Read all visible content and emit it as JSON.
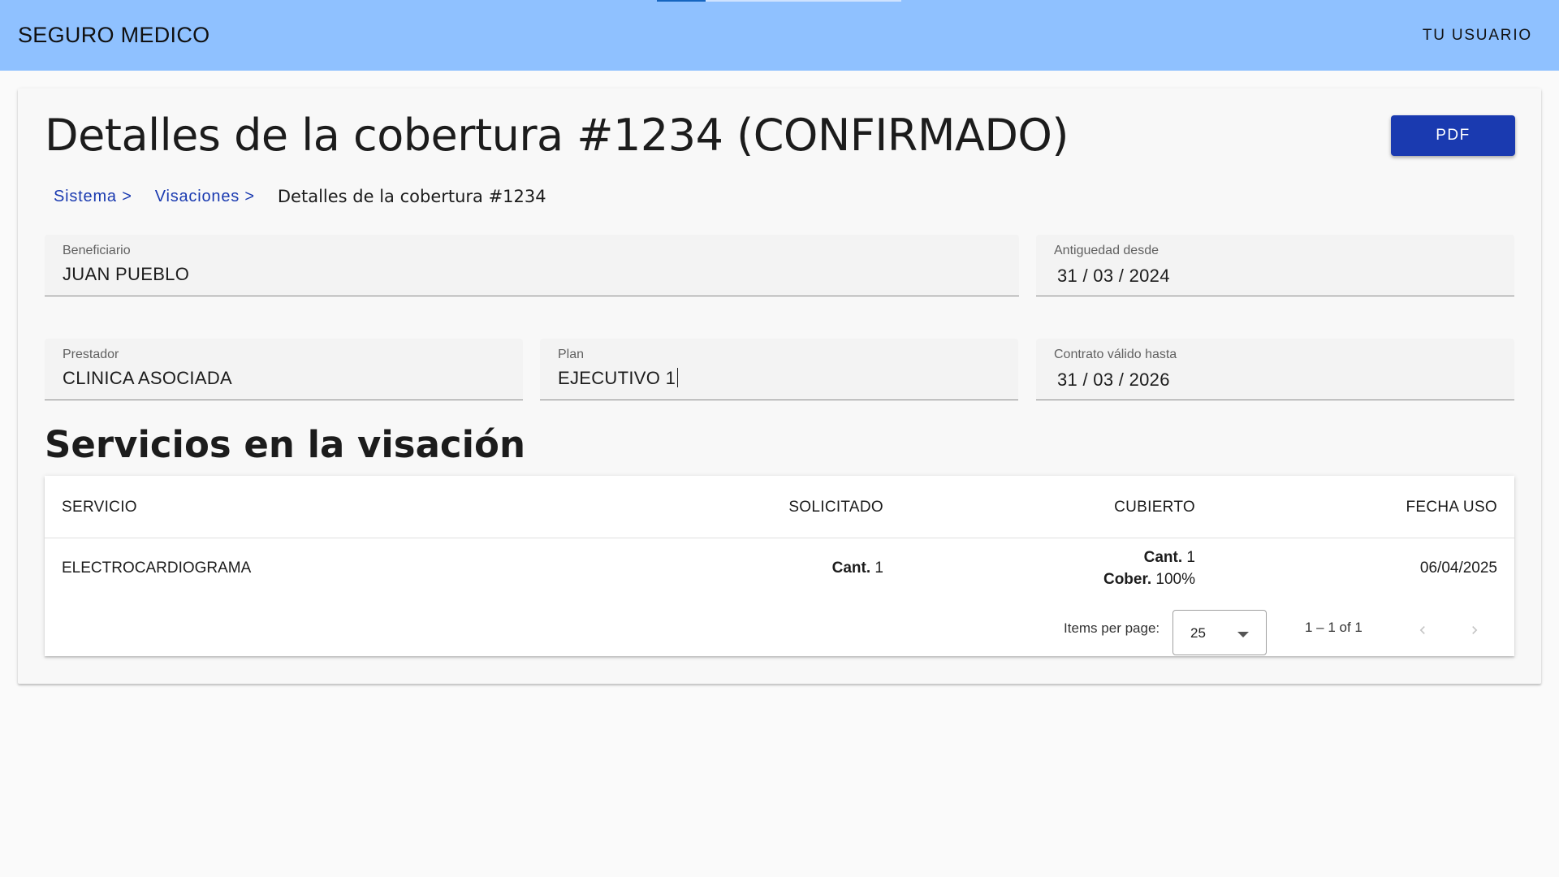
{
  "app": {
    "title": "SEGURO MEDICO",
    "user_menu": "TU USUARIO",
    "loading_progress": 0.2
  },
  "page": {
    "title": "Detalles de la cobertura #1234 (CONFIRMADO)",
    "pdf_label": "PDF",
    "breadcrumb": [
      {
        "label": "Sistema >"
      },
      {
        "label": "Visaciones >"
      },
      {
        "label": "Detalles de la cobertura #1234"
      }
    ]
  },
  "fields": {
    "beneficiario": {
      "label": "Beneficiario",
      "value": "JUAN PUEBLO"
    },
    "antiguedad": {
      "label": "Antiguedad desde",
      "value": "31 / 03 / 2024"
    },
    "prestador": {
      "label": "Prestador",
      "value": "CLINICA ASOCIADA"
    },
    "plan": {
      "label": "Plan",
      "value": "EJECUTIVO 1"
    },
    "contrato": {
      "label": "Contrato válido hasta",
      "value": "31 / 03 / 2026"
    }
  },
  "services": {
    "title": "Servicios en la visación",
    "columns": [
      "SERVICIO",
      "SOLICITADO",
      "CUBIERTO",
      "FECHA USO"
    ],
    "rows": [
      {
        "servicio": "ELECTROCARDIOGRAMA",
        "solicitado_label": "Cant.",
        "solicitado_value": "1",
        "cubierto_cant_label": "Cant.",
        "cubierto_cant_value": "1",
        "cubierto_cober_label": "Cober.",
        "cubierto_cober_value": "100%",
        "fecha_uso": "06/04/2025"
      }
    ]
  },
  "paginator": {
    "items_per_page_label": "Items per page:",
    "page_size": "25",
    "range": "1 – 1 of 1",
    "prev_icon": "chevron-left-icon",
    "next_icon": "chevron-right-icon"
  },
  "colors": {
    "toolbar": "#8fc1ff",
    "primary_button": "#1a3ab0",
    "link": "#1a3ab0"
  }
}
